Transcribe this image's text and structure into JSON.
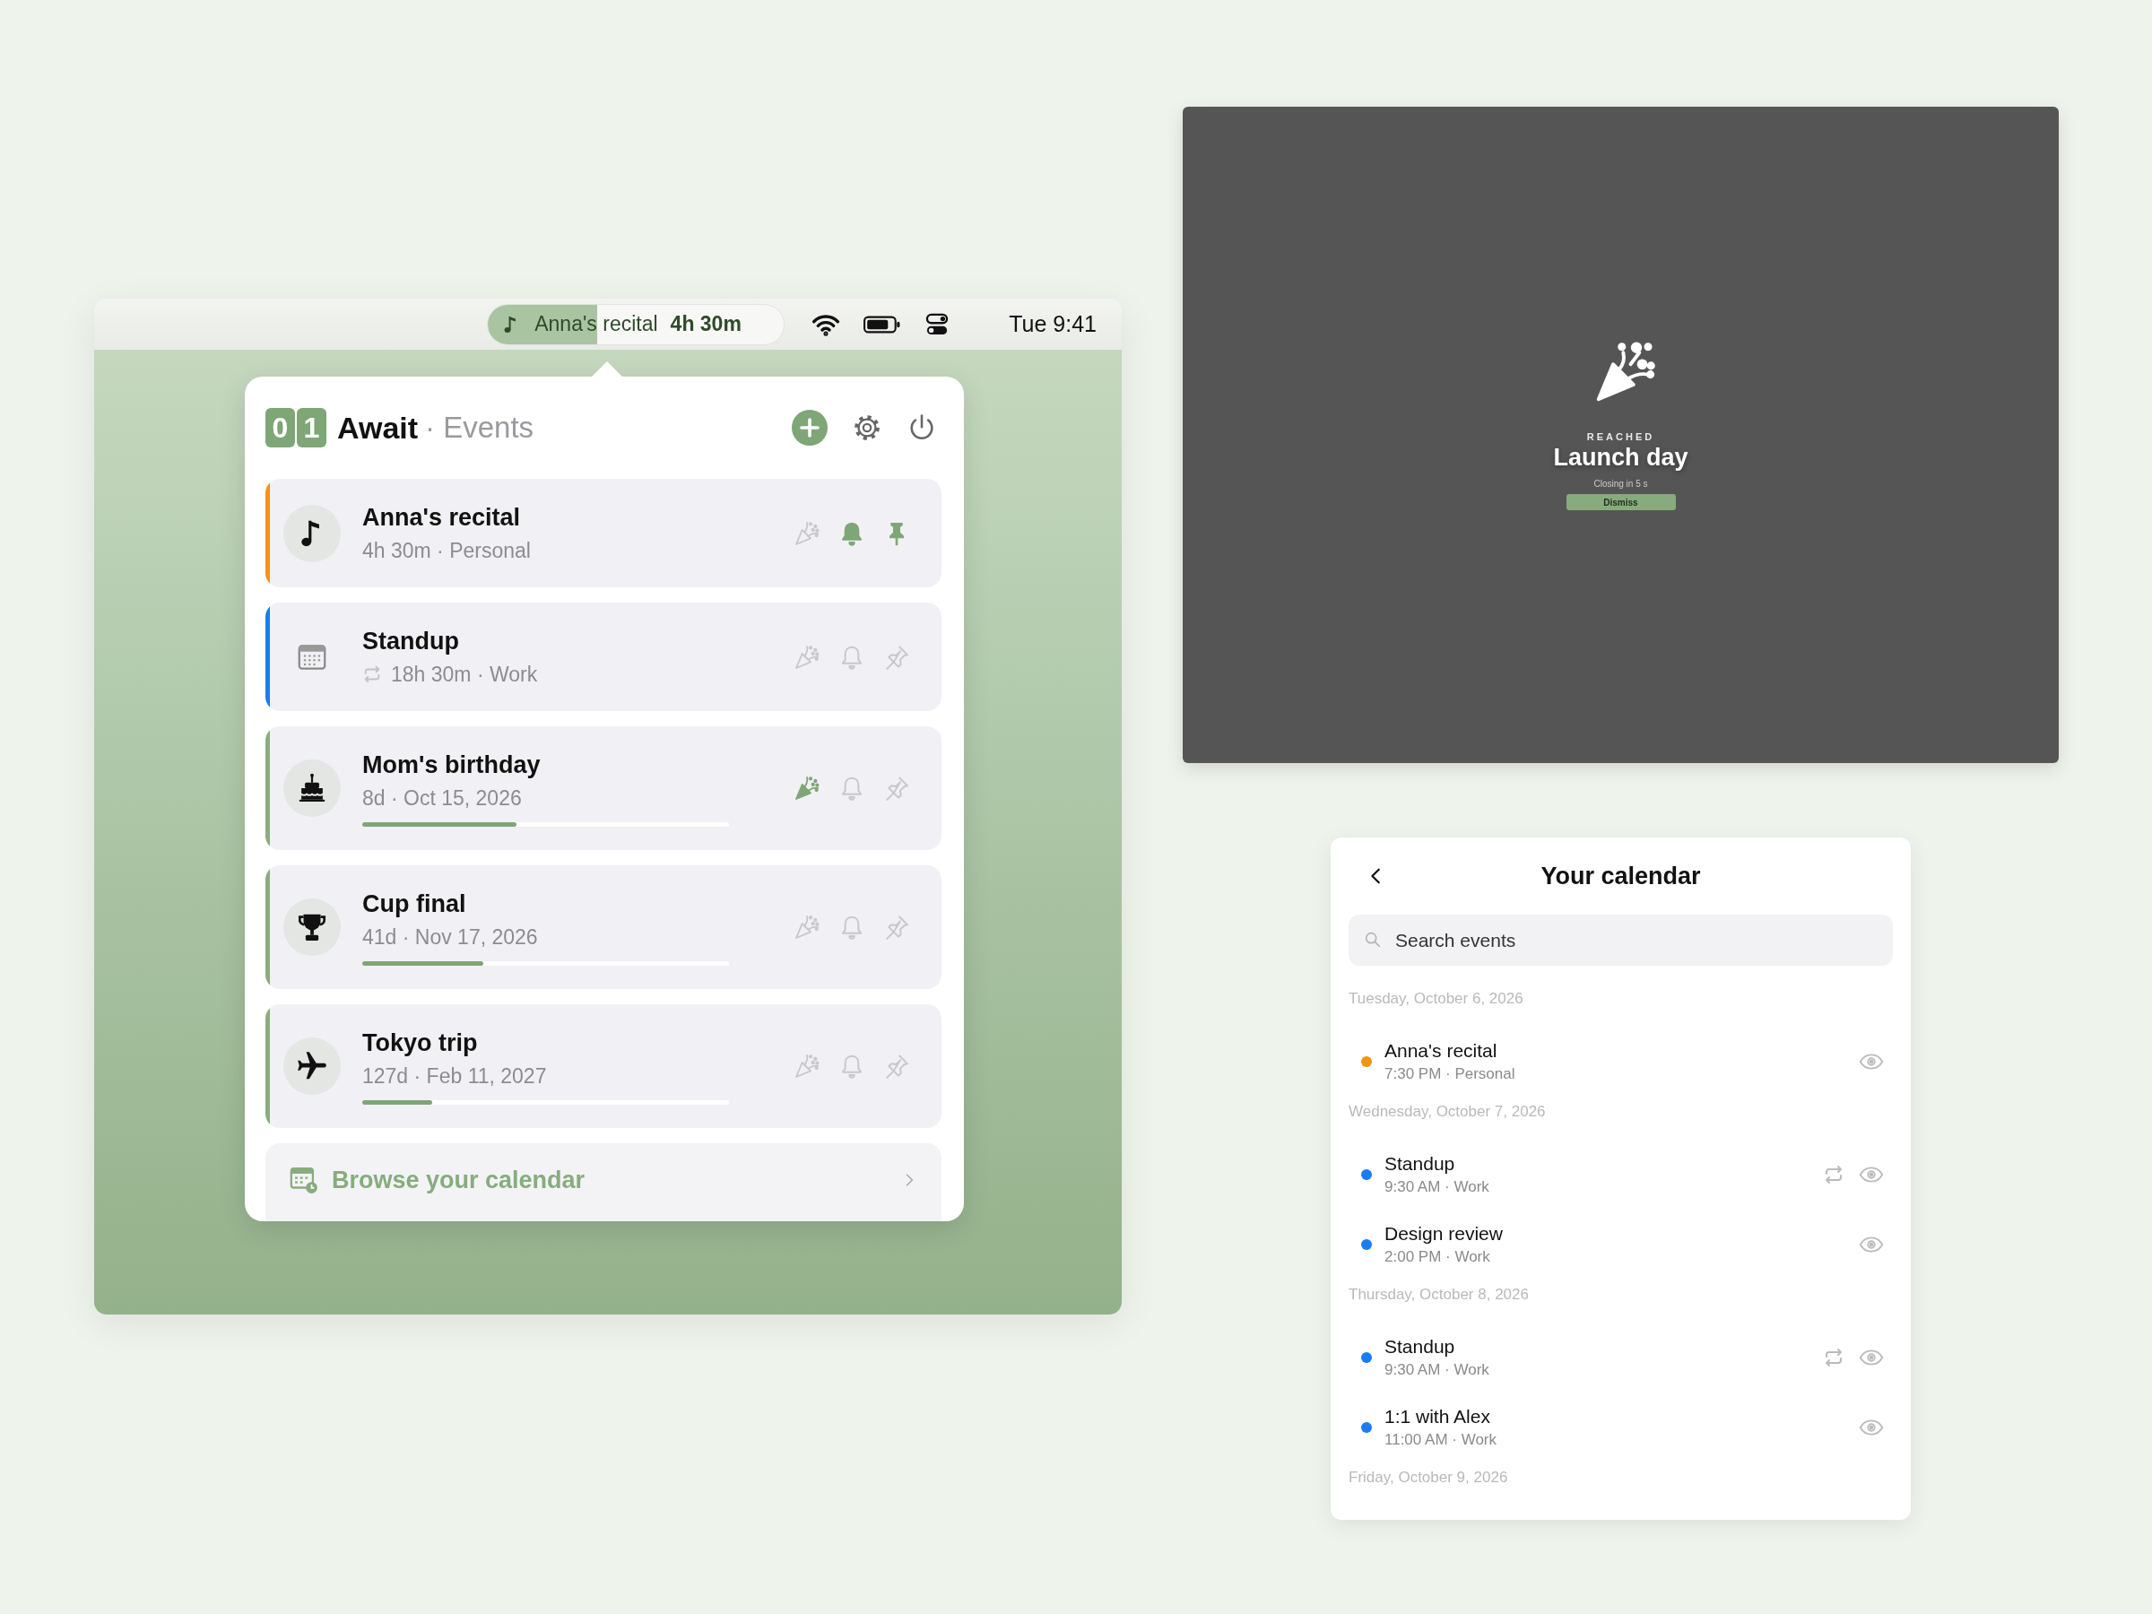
{
  "menubar": {
    "countdown": {
      "title": "Anna's recital",
      "remaining": "4h 30m",
      "level": 0.37
    },
    "clock": "Tue 9:41"
  },
  "popover": {
    "logo_digits": [
      "0",
      "1"
    ],
    "app_name": "Await",
    "section": "· Events",
    "events": [
      {
        "kind": "music",
        "title": "Anna's recital",
        "subtitle": "4h 30m · Personal",
        "color": "#f0960e",
        "repeating": false,
        "celebrate": false,
        "alert": true,
        "pinned": true
      },
      {
        "kind": "calendar",
        "title": "Standup",
        "subtitle": "18h 30m · Work",
        "color": "#1a7cf5",
        "repeating": true,
        "celebrate": false,
        "alert": false,
        "pinned": false
      },
      {
        "kind": "cake",
        "title": "Mom's birthday",
        "subtitle": "8d · Oct 15, 2026",
        "color": "#8bac7f",
        "level": 0.42,
        "repeating": false,
        "celebrate": true,
        "alert": false,
        "pinned": false
      },
      {
        "kind": "trophy",
        "title": "Cup final",
        "subtitle": "41d · Nov 17, 2026",
        "color": "#8bac7f",
        "level": 0.33,
        "repeating": false,
        "celebrate": false,
        "alert": false,
        "pinned": false
      },
      {
        "kind": "plane",
        "title": "Tokyo trip",
        "subtitle": "127d · Feb 11, 2027",
        "color": "#8bac7f",
        "level": 0.19,
        "repeating": false,
        "celebrate": false,
        "alert": false,
        "pinned": false
      }
    ],
    "browse": "Browse your calendar"
  },
  "celebration": {
    "eyebrow": "REACHED",
    "title": "Launch day",
    "note": "Closing in 5 s",
    "button": "Dismiss"
  },
  "calendar": {
    "title": "Your calendar",
    "search": {
      "placeholder": "Search events"
    },
    "days": [
      {
        "date": "Tuesday, October 6, 2026",
        "events": [
          {
            "title": "Anna's recital",
            "subtitle": "7:30 PM · Personal",
            "color": "#f0960e",
            "repeating": false
          }
        ]
      },
      {
        "date": "Wednesday, October 7, 2026",
        "events": [
          {
            "title": "Standup",
            "subtitle": "9:30 AM · Work",
            "color": "#1a7cf5",
            "repeating": true
          },
          {
            "title": "Design review",
            "subtitle": "2:00 PM · Work",
            "color": "#1a7cf5",
            "repeating": false
          }
        ]
      },
      {
        "date": "Thursday, October 8, 2026",
        "events": [
          {
            "title": "Standup",
            "subtitle": "9:30 AM · Work",
            "color": "#1a7cf5",
            "repeating": true
          },
          {
            "title": "1:1 with Alex",
            "subtitle": "11:00 AM · Work",
            "color": "#1a7cf5",
            "repeating": false
          }
        ]
      },
      {
        "date": "Friday, October 9, 2026"
      }
    ]
  }
}
